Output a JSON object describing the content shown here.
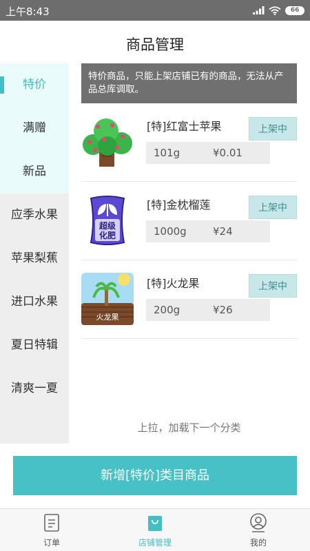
{
  "status_bar": {
    "time": "上午8:43",
    "battery": "66",
    "icons": [
      "signal-icon",
      "wifi-icon",
      "battery-icon"
    ]
  },
  "header": {
    "title": "商品管理"
  },
  "sidebar": {
    "items": [
      {
        "label": "特价",
        "active": true
      },
      {
        "label": "满赠"
      },
      {
        "label": "新品"
      },
      {
        "label": "应季水果"
      },
      {
        "label": "苹果梨蕉"
      },
      {
        "label": "进口水果"
      },
      {
        "label": "夏日特辑"
      },
      {
        "label": "清爽一夏"
      }
    ]
  },
  "notice": {
    "text": "特价商品，只能上架店铺已有的商品，无法从产品总库调取。"
  },
  "products": [
    {
      "name": "[特]红富士苹果",
      "status": "上架中",
      "weight": "101g",
      "price": "¥0.01",
      "icon": "apple-tree-icon"
    },
    {
      "name": "[特]金枕榴莲",
      "status": "上架中",
      "weight": "1000g",
      "price": "¥24",
      "icon": "fertilizer-bag-icon",
      "bag_text": "超级化肥"
    },
    {
      "name": "[特]火龙果",
      "status": "上架中",
      "weight": "200g",
      "price": "¥26",
      "icon": "farm-landscape-icon",
      "image_text": "火龙果"
    }
  ],
  "load_more": "上拉，加载下一个分类",
  "add_button": "新增[特价]类目商品",
  "tabs": [
    {
      "label": "订单",
      "icon": "document-icon"
    },
    {
      "label": "店铺管理",
      "icon": "shopping-bag-icon",
      "active": true
    },
    {
      "label": "我的",
      "icon": "user-icon"
    }
  ],
  "colors": {
    "accent": "#43bec3",
    "button": "#47c1c5",
    "status_bar": "#6d6d6d",
    "notice_bg": "#707070",
    "status_tag_bg": "#c8e7e8"
  }
}
